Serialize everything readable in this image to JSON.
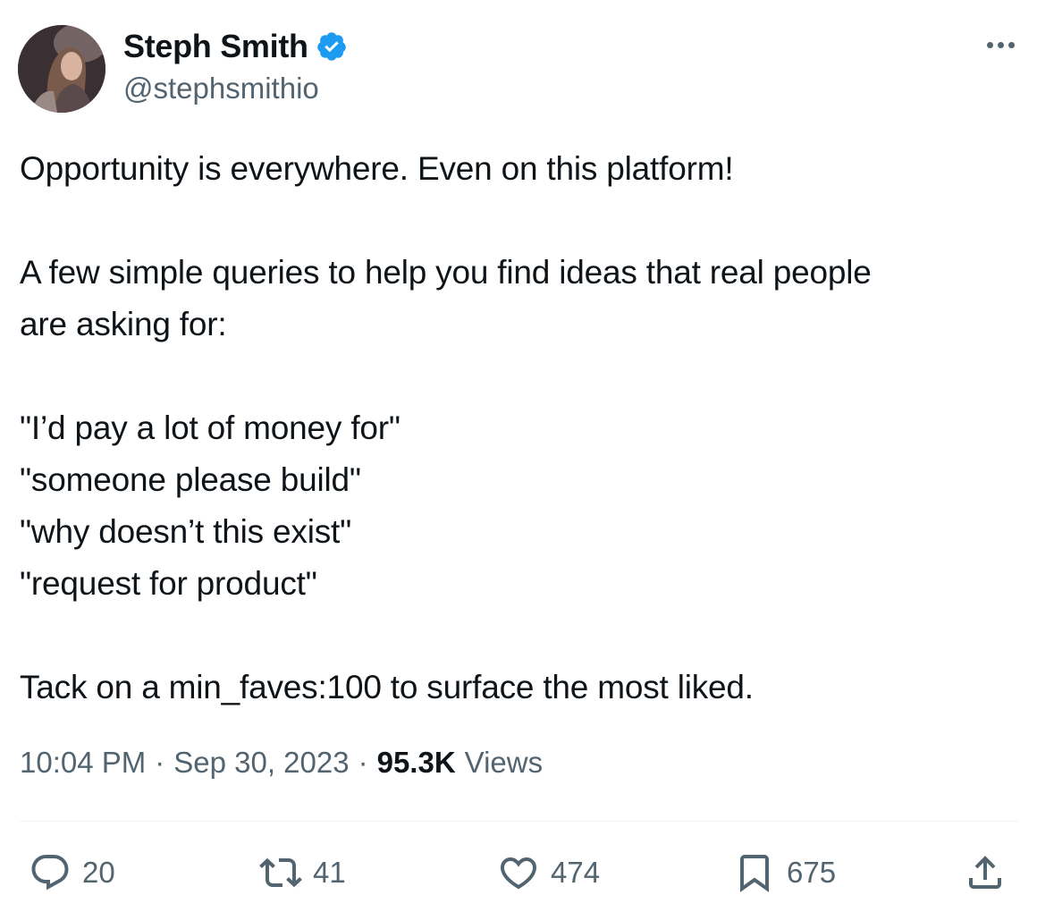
{
  "author": {
    "display_name": "Steph Smith",
    "handle": "@stephsmithio",
    "verified": true
  },
  "tweet": {
    "lines": [
      "Opportunity is everywhere. Even on this platform!",
      "",
      "A few simple queries to help you find ideas that real people",
      "are asking for:",
      "",
      "\"I’d pay a lot of money for\"",
      "\"someone please build\"",
      "\"why doesn’t this exist\"",
      "\"request for product\"",
      "",
      "Tack on a min_faves:100 to surface the most liked."
    ],
    "time": "10:04 PM",
    "date": "Sep 30, 2023",
    "views_count": "95.3K",
    "views_label": "Views",
    "separator": "·"
  },
  "actions": {
    "replies": "20",
    "retweets": "41",
    "likes": "474",
    "bookmarks": "675"
  },
  "colors": {
    "text": "#0f1419",
    "secondary": "#536471",
    "verified": "#1d9bf0",
    "divider": "#eff3f4"
  },
  "icons": [
    "verified-badge-icon",
    "more-icon",
    "reply-icon",
    "retweet-icon",
    "like-icon",
    "bookmark-icon",
    "share-icon"
  ]
}
